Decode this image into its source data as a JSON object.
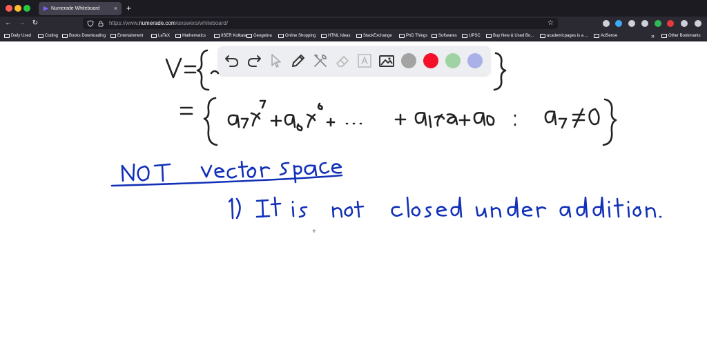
{
  "window": {
    "tab_title": "Numerade Whiteboard",
    "tab_close": "×",
    "new_tab": "+"
  },
  "navigation": {
    "back": "←",
    "forward": "→",
    "reload": "↻",
    "url_prefix": "https://www.",
    "url_host": "numerade.com",
    "url_path": "/answers/whiteboard/",
    "bookmark_star": "☆"
  },
  "extensions": [
    {
      "icon": "pocket-icon",
      "color": "#cfcfd8"
    },
    {
      "icon": "download-icon",
      "color": "#3fa9f5"
    },
    {
      "icon": "extension-icon",
      "color": "#cfcfd8"
    },
    {
      "icon": "green-extension-icon",
      "color": "#2fb85a"
    },
    {
      "icon": "avatar-icon",
      "color": "#cfcfd8"
    },
    {
      "icon": "adblock-icon",
      "color": "#e5393c"
    },
    {
      "icon": "pen-icon",
      "color": "#cfcfd8"
    },
    {
      "icon": "menu-icon",
      "color": "#cfcfd8"
    }
  ],
  "bookmarks": [
    "Daily Used",
    "Coding",
    "Books Downloading",
    "Entertainment",
    "LaTeX",
    "Mathematics",
    "IISER Kolkata",
    "Geogebra",
    "Online Shopping",
    "HTML Ideas",
    "StackExchange",
    "PhD Things",
    "Softwares",
    "UPSC",
    "Buy New & Used Bo...",
    "academicpages is a ...",
    "AdSense"
  ],
  "other_bookmarks": "Other Bookmarks",
  "bookmarks_overflow": "»",
  "whiteboard": {
    "handwriting": [
      "V = { ... }",
      "= { a₇x⁷ + a₆x⁶ + ... + a₁x + a₀ : a₇ ≠ 0 }",
      "NOT vector space",
      "1) It is not closed under addition."
    ],
    "ink_color": "#1230b8",
    "ink_color_dark": "#222222"
  },
  "toolbar": {
    "tools": [
      "undo-icon",
      "redo-icon",
      "select-icon",
      "pen-icon",
      "tools-icon",
      "eraser-icon",
      "text-icon",
      "image-icon"
    ],
    "colors": [
      "#a3a3a3",
      "#f5102a",
      "#9fd3a3",
      "#aab0e8"
    ]
  },
  "cursor": "+"
}
